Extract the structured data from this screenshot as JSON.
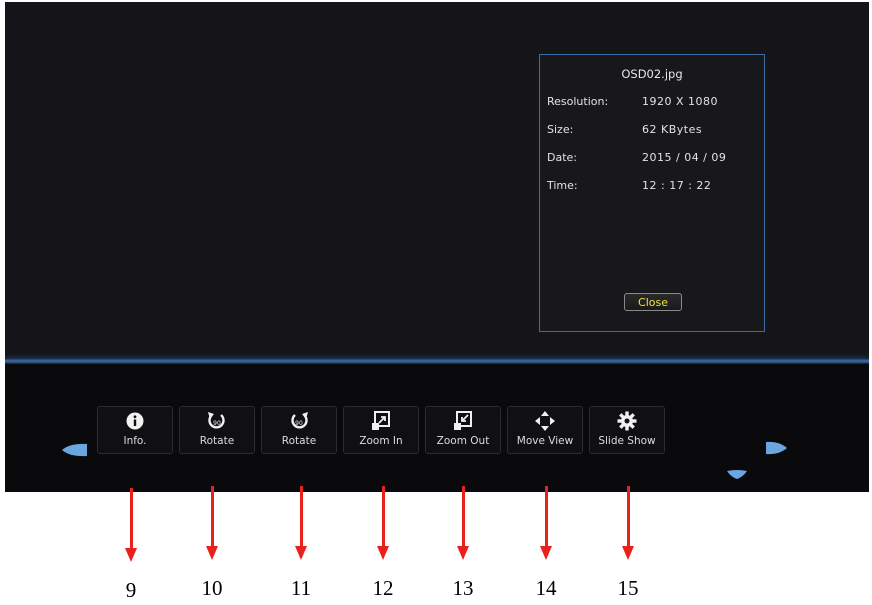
{
  "info_panel": {
    "file_name": "OSD02.jpg",
    "rows": [
      {
        "label": "Resolution:",
        "value": "1920 X 1080"
      },
      {
        "label": "Size:",
        "value": "62 KBytes"
      },
      {
        "label": "Date:",
        "value": "2015 / 04 / 09"
      },
      {
        "label": "Time:",
        "value": "12 : 17 : 22"
      }
    ],
    "close_label": "Close"
  },
  "toolbar": {
    "buttons": [
      {
        "label": "Info.",
        "icon": "info-icon"
      },
      {
        "label": "Rotate",
        "icon": "rotate-ccw-90-icon"
      },
      {
        "label": "Rotate",
        "icon": "rotate-cw-90-icon"
      },
      {
        "label": "Zoom In",
        "icon": "zoom-in-icon"
      },
      {
        "label": "Zoom Out",
        "icon": "zoom-out-icon"
      },
      {
        "label": "Move View",
        "icon": "move-view-icon"
      },
      {
        "label": "Slide Show",
        "icon": "gear-icon"
      }
    ],
    "rotate_icon_text": "90"
  },
  "callouts": [
    "9",
    "10",
    "11",
    "12",
    "13",
    "14",
    "15"
  ],
  "colors": {
    "accent_blue": "#3a6ea5",
    "close_text": "#f2e14a",
    "callout_red": "#e8211c",
    "screen_bg": "#141418"
  }
}
